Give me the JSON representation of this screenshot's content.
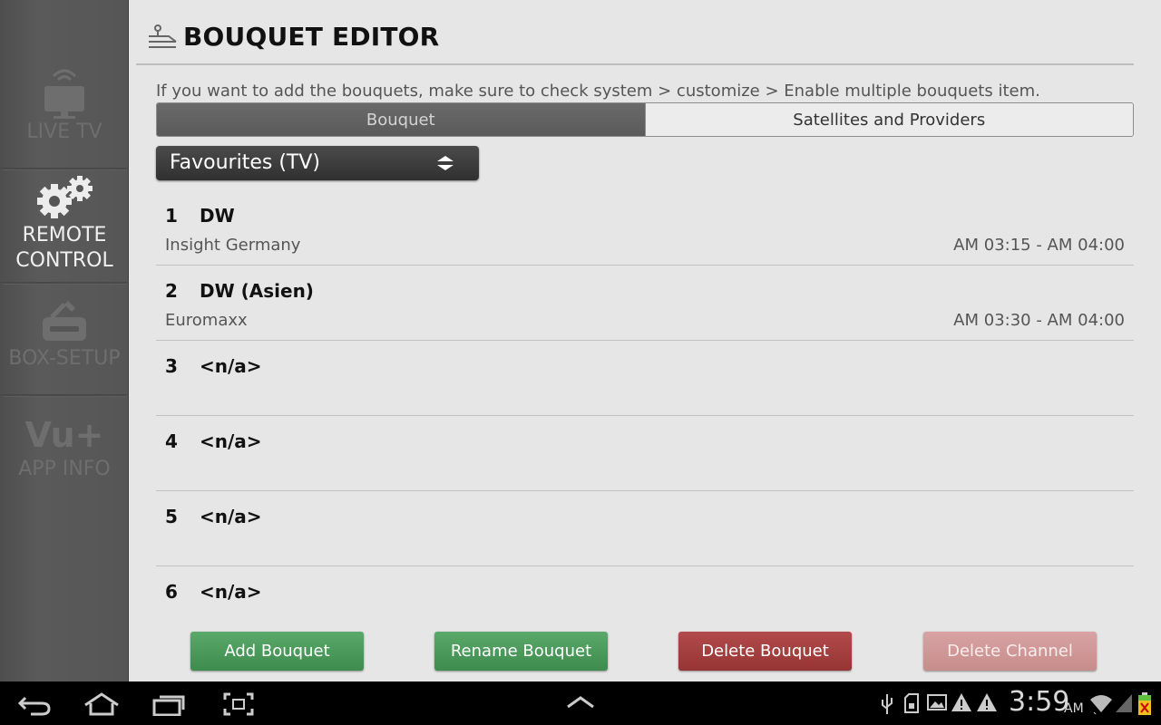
{
  "sidebar": {
    "items": [
      {
        "label": "LIVE TV",
        "icon": "tv-icon"
      },
      {
        "label": "REMOTE\nCONTROL",
        "label_line1": "REMOTE",
        "label_line2": "CONTROL",
        "icon": "gears-icon",
        "active": true
      },
      {
        "label": "BOX-SETUP",
        "icon": "router-icon"
      },
      {
        "label": "APP INFO",
        "icon": "vu-plus-logo",
        "logo_text": "Vu+"
      }
    ]
  },
  "header": {
    "title": "BOUQUET EDITOR",
    "icon": "bouquet-editor-icon"
  },
  "info_text": "If you want to add the bouquets, make sure to check system > customize > Enable multiple bouquets item.",
  "tabs": [
    {
      "label": "Bouquet",
      "selected": true
    },
    {
      "label": "Satellites and Providers",
      "selected": false
    }
  ],
  "bouquet_select": {
    "value": "Favourites (TV)"
  },
  "channels": [
    {
      "num": "1",
      "name": "DW",
      "program": "Insight Germany",
      "time": "AM 03:15 - AM 04:00"
    },
    {
      "num": "2",
      "name": "DW (Asien)",
      "program": "Euromaxx",
      "time": "AM 03:30 - AM 04:00"
    },
    {
      "num": "3",
      "name": "<n/a>",
      "program": "",
      "time": ""
    },
    {
      "num": "4",
      "name": "<n/a>",
      "program": "",
      "time": ""
    },
    {
      "num": "5",
      "name": "<n/a>",
      "program": "",
      "time": ""
    },
    {
      "num": "6",
      "name": "<n/a>",
      "program": "",
      "time": ""
    }
  ],
  "buttons": {
    "add": "Add Bouquet",
    "rename": "Rename Bouquet",
    "delete_bouquet": "Delete Bouquet",
    "delete_channel": "Delete Channel"
  },
  "colors": {
    "add_button": "#4a9a5b",
    "delete_button": "#a43f3f",
    "delete_channel_button": "#d09898",
    "sidebar": "#555555"
  },
  "status_bar": {
    "time": "3:59",
    "ampm": "AM",
    "icons": [
      "back-icon",
      "home-icon",
      "recent-apps-icon",
      "screenshot-icon",
      "up-arrow-icon",
      "usb-icon",
      "sd-card-icon",
      "gallery-icon",
      "warning-icon",
      "warning-icon",
      "wifi-icon",
      "signal-icon",
      "battery-icon"
    ]
  }
}
